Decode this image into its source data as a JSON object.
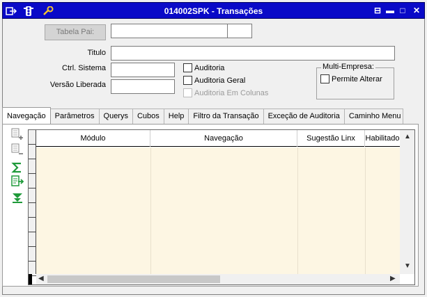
{
  "window": {
    "title": "014002SPK - Transações",
    "icons": [
      "exit-icon",
      "traffic-light-icon",
      "wrench-icon"
    ],
    "controls": {
      "restore": "⊟",
      "minimize": "▬",
      "maximize": "□",
      "close": "✕"
    }
  },
  "form": {
    "tabela_pai_label": "Tabela Pai:",
    "titulo_label": "Titulo",
    "ctrl_sistema_label": "Ctrl. Sistema",
    "versao_label": "Versão Liberada",
    "auditoria": "Auditoria",
    "auditoria_geral": "Auditoria Geral",
    "auditoria_colunas": "Auditoria Em Colunas",
    "multi_empresa": "Multi-Empresa:",
    "permite_alterar": "Permite Alterar"
  },
  "tabs": [
    "Navegação",
    "Parâmetros",
    "Querys",
    "Cubos",
    "Help",
    "Filtro da Transação",
    "Exceção de Auditoria",
    "Caminho Menu"
  ],
  "grid": {
    "columns": [
      "Módulo",
      "Navegação",
      "Sugestão Linx",
      "Habilitado"
    ]
  },
  "side_icons": [
    "add-row-icon",
    "remove-row-icon",
    "sigma-icon",
    "export-icon",
    "expand-down-icon"
  ],
  "colors": {
    "title_bar": "#0a0ac8",
    "grid_body": "#fdf6e3",
    "accent_green": "#1f9a3a"
  }
}
